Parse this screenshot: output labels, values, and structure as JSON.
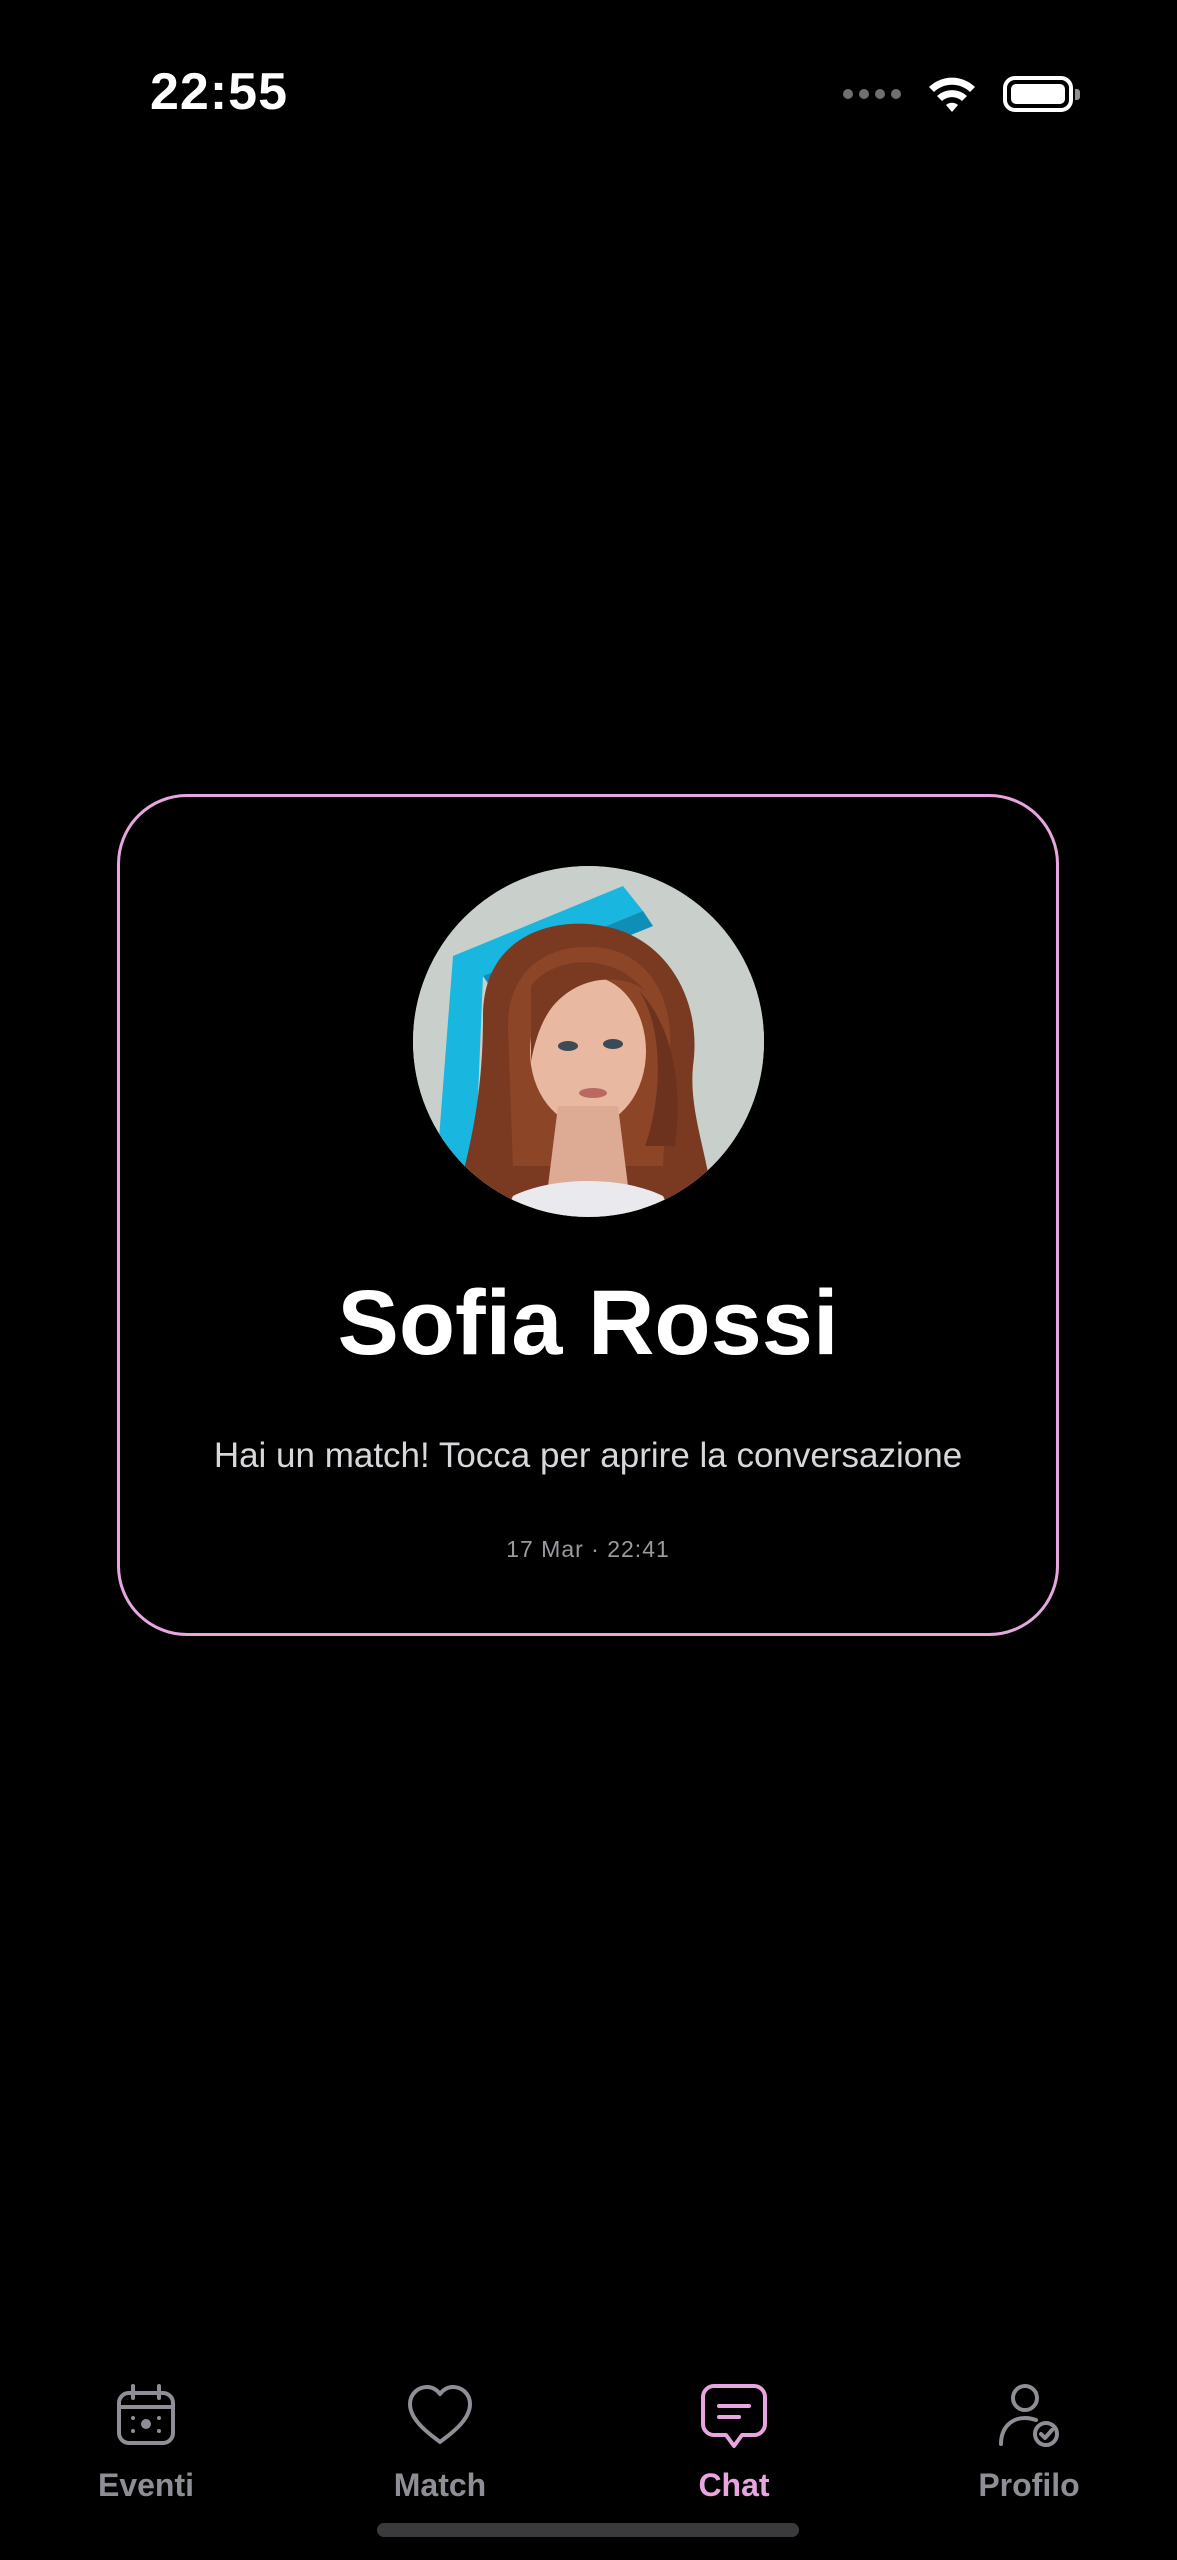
{
  "status_bar": {
    "time": "22:55",
    "icons": [
      "cellular-signal-icon",
      "wifi-icon",
      "battery-icon"
    ]
  },
  "match_card": {
    "name": "Sofia Rossi",
    "message": "Hai un match! Tocca per aprire la conversazione",
    "timestamp": "17 Mar · 22:41",
    "avatar_icon": "profile-photo",
    "border_color": "#e8a6e0"
  },
  "tab_bar": {
    "active_tab": "Chat",
    "accent_color": "#e8a6e0",
    "inactive_color": "#8e8e96",
    "tabs": [
      {
        "label": "Eventi",
        "icon": "calendar-icon"
      },
      {
        "label": "Match",
        "icon": "heart-icon"
      },
      {
        "label": "Chat",
        "icon": "chat-bubble-icon"
      },
      {
        "label": "Profilo",
        "icon": "profile-check-icon"
      }
    ]
  }
}
